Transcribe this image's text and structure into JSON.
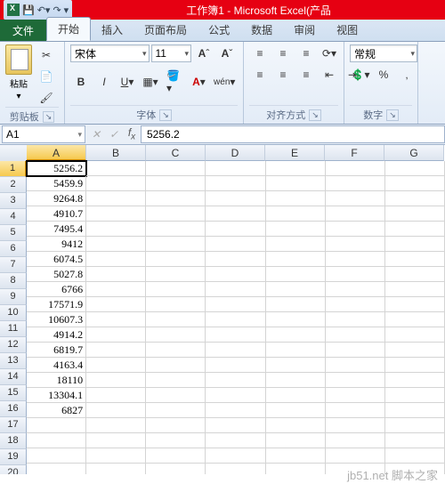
{
  "title": "工作簿1 - Microsoft Excel(产品",
  "tabs": {
    "file": "文件",
    "home": "开始",
    "insert": "插入",
    "layout": "页面布局",
    "formulas": "公式",
    "data": "数据",
    "review": "审阅",
    "view": "视图"
  },
  "groups": {
    "clipboard": "剪贴板",
    "font": "字体",
    "alignment": "对齐方式",
    "number": "数字"
  },
  "clipboard": {
    "paste": "粘贴"
  },
  "font": {
    "name": "宋体",
    "size": "11",
    "bold": "B",
    "italic": "I",
    "underline": "U"
  },
  "number": {
    "format": "常规"
  },
  "cellRef": "A1",
  "cellValue": "5256.2",
  "cols": [
    "A",
    "B",
    "C",
    "D",
    "E",
    "F",
    "G"
  ],
  "rowCount": 21,
  "dataA": [
    "5256.2",
    "5459.9",
    "9264.8",
    "4910.7",
    "7495.4",
    "9412",
    "6074.5",
    "5027.8",
    "6766",
    "17571.9",
    "10607.3",
    "4914.2",
    "6819.7",
    "4163.4",
    "18110",
    "13304.1",
    "6827",
    "",
    "",
    "",
    ""
  ],
  "watermark": {
    "url": "jb51.net",
    "cn": "脚本之家"
  }
}
